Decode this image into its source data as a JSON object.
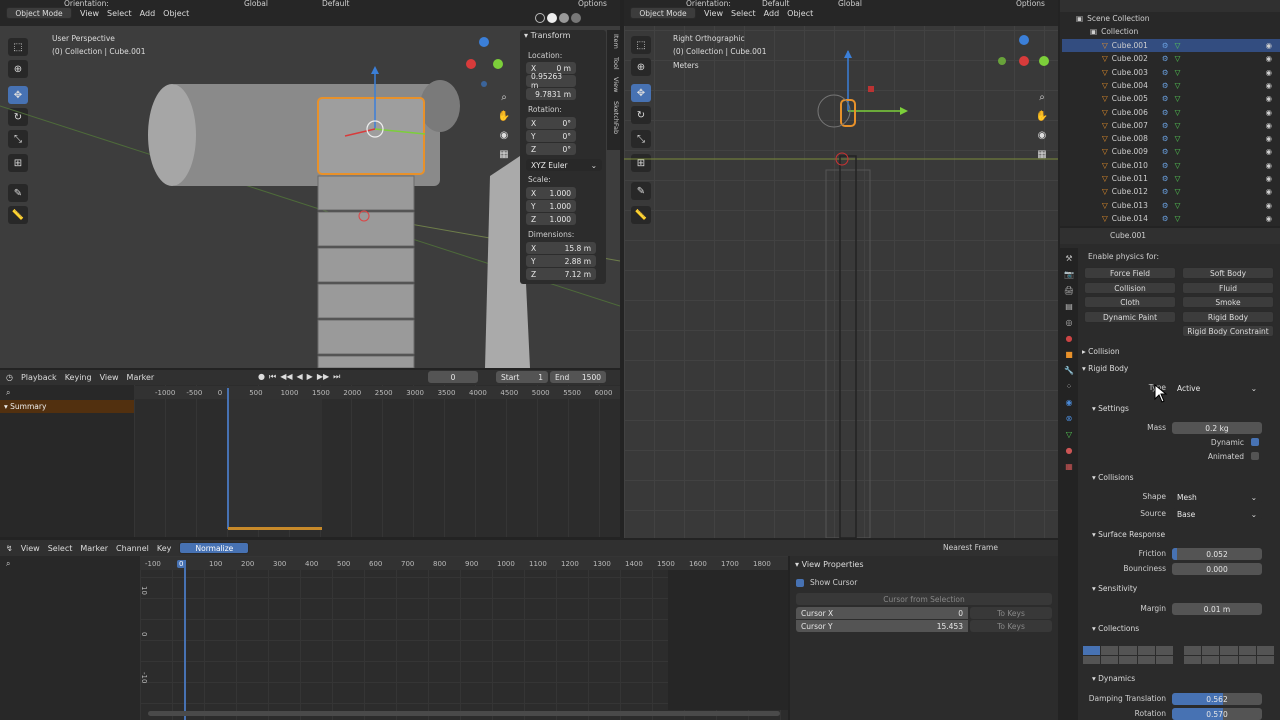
{
  "viewport_left": {
    "header": {
      "mode": "Object Mode",
      "menus": [
        "View",
        "Select",
        "Add",
        "Object"
      ],
      "orientation_label": "Orientation:",
      "orientation": "Global",
      "default": "Default",
      "options": "Options"
    },
    "info": {
      "view": "User Perspective",
      "collection": "(0) Collection | Cube.001"
    },
    "npanel": {
      "title": "Transform",
      "tabs": [
        "Item",
        "Tool",
        "View",
        "SketchFab"
      ],
      "location_label": "Location:",
      "location": [
        {
          "axis": "X",
          "value": "0 m"
        },
        {
          "axis": "",
          "value": "0.95263 m"
        },
        {
          "axis": "",
          "value": "9.7831 m"
        }
      ],
      "rotation_label": "Rotation:",
      "rotation": [
        {
          "axis": "X",
          "value": "0°"
        },
        {
          "axis": "Y",
          "value": "0°"
        },
        {
          "axis": "Z",
          "value": "0°"
        }
      ],
      "euler": "XYZ Euler",
      "scale_label": "Scale:",
      "scale": [
        {
          "axis": "X",
          "value": "1.000"
        },
        {
          "axis": "Y",
          "value": "1.000"
        },
        {
          "axis": "Z",
          "value": "1.000"
        }
      ],
      "dims_label": "Dimensions:",
      "dims": [
        {
          "axis": "X",
          "value": "15.8 m"
        },
        {
          "axis": "Y",
          "value": "2.88 m"
        },
        {
          "axis": "Z",
          "value": "7.12 m"
        }
      ]
    }
  },
  "viewport_right": {
    "header": {
      "mode": "Object Mode",
      "menus": [
        "View",
        "Select",
        "Add",
        "Object"
      ],
      "orientation_label": "Orientation:",
      "orientation": "Global",
      "default": "Default",
      "options": "Options"
    },
    "info": {
      "view": "Right Orthographic",
      "collection": "(0) Collection | Cube.001",
      "units": "Meters"
    }
  },
  "timeline": {
    "menus": [
      "Playback",
      "Keying",
      "View",
      "Marker"
    ],
    "current_frame": "0",
    "start_label": "Start",
    "start": "1",
    "end_label": "End",
    "end": "1500",
    "summary": "Summary",
    "ticks": [
      "-1000",
      "-500",
      "0",
      "500",
      "1000",
      "1500",
      "2000",
      "2500",
      "3000",
      "3500",
      "4000",
      "4500",
      "5000",
      "5500",
      "6000"
    ]
  },
  "graph_editor": {
    "menus": [
      "View",
      "Select",
      "Marker",
      "Channel",
      "Key"
    ],
    "normalize": "Normalize",
    "pivot": "Nearest Frame",
    "ticks": [
      "-100",
      "0",
      "100",
      "200",
      "300",
      "400",
      "500",
      "600",
      "700",
      "800",
      "900",
      "1000",
      "1100",
      "1200",
      "1300",
      "1400",
      "1500",
      "1600",
      "1700",
      "1800"
    ],
    "yticks": [
      "10",
      "0",
      "-10"
    ],
    "view_properties": {
      "title": "View Properties",
      "show_cursor": "Show Cursor",
      "cursor_from_selection": "Cursor from Selection",
      "cursor_x_label": "Cursor X",
      "cursor_x": "0",
      "cursor_y_label": "Cursor Y",
      "cursor_y": "15.453",
      "to_keys": "To Keys"
    }
  },
  "outliner": {
    "scene": "Scene Collection",
    "collection": "Collection",
    "items": [
      "Cube.001",
      "Cube.002",
      "Cube.003",
      "Cube.004",
      "Cube.005",
      "Cube.006",
      "Cube.007",
      "Cube.008",
      "Cube.009",
      "Cube.010",
      "Cube.011",
      "Cube.012",
      "Cube.013",
      "Cube.014"
    ]
  },
  "properties": {
    "object": "Cube.001",
    "enable_physics": "Enable physics for:",
    "physics": [
      [
        "Force Field",
        "Soft Body"
      ],
      [
        "Collision",
        "Fluid"
      ],
      [
        "Cloth",
        "Smoke"
      ],
      [
        "Dynamic Paint",
        "Rigid Body"
      ],
      [
        "",
        "Rigid Body Constraint"
      ]
    ],
    "collision": "Collision",
    "rigid_body": "Rigid Body",
    "type_label": "Type",
    "type": "Active",
    "settings": "Settings",
    "mass_label": "Mass",
    "mass": "0.2 kg",
    "dynamic": "Dynamic",
    "animated": "Animated",
    "collisions": "Collisions",
    "shape_label": "Shape",
    "shape": "Mesh",
    "source_label": "Source",
    "source": "Base",
    "surface_response": "Surface Response",
    "friction_label": "Friction",
    "friction": "0.052",
    "friction_frac": 0.052,
    "bounciness_label": "Bounciness",
    "bounciness": "0.000",
    "sensitivity": "Sensitivity",
    "margin_label": "Margin",
    "margin": "0.01 m",
    "collections": "Collections",
    "dynamics": "Dynamics",
    "damp_t_label": "Damping Translation",
    "damp_t": "0.562",
    "damp_t_frac": 0.562,
    "damp_r_label": "Rotation",
    "damp_r": "0.570",
    "damp_r_frac": 0.57
  },
  "colors": {
    "accent": "#4772b3",
    "selected_orange": "#e8912a",
    "header": "#303030",
    "panel": "#2b2b2b"
  }
}
